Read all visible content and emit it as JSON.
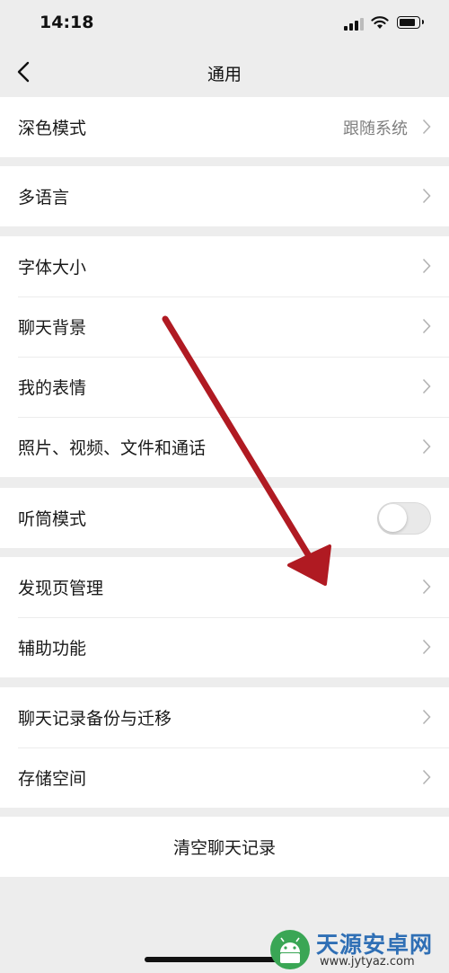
{
  "status_bar": {
    "time": "14:18"
  },
  "navbar": {
    "title": "通用"
  },
  "groups": [
    {
      "items": [
        {
          "label": "深色模式",
          "value": "跟随系统"
        }
      ]
    },
    {
      "items": [
        {
          "label": "多语言"
        }
      ]
    },
    {
      "items": [
        {
          "label": "字体大小"
        },
        {
          "label": "聊天背景"
        },
        {
          "label": "我的表情"
        },
        {
          "label": "照片、视频、文件和通话"
        }
      ]
    },
    {
      "items": [
        {
          "label": "听筒模式",
          "toggle": false
        }
      ]
    },
    {
      "items": [
        {
          "label": "发现页管理"
        },
        {
          "label": "辅助功能"
        }
      ]
    },
    {
      "items": [
        {
          "label": "聊天记录备份与迁移"
        },
        {
          "label": "存储空间"
        }
      ]
    }
  ],
  "clear_button": {
    "label": "清空聊天记录"
  },
  "annotation": {
    "type": "red-arrow",
    "color": "#b01a22"
  },
  "watermark": {
    "title": "天源安卓网",
    "url": "www.jytyaz.com"
  },
  "colors": {
    "background": "#ededed",
    "card": "#ffffff",
    "secondary_text": "#7f7f7f"
  }
}
